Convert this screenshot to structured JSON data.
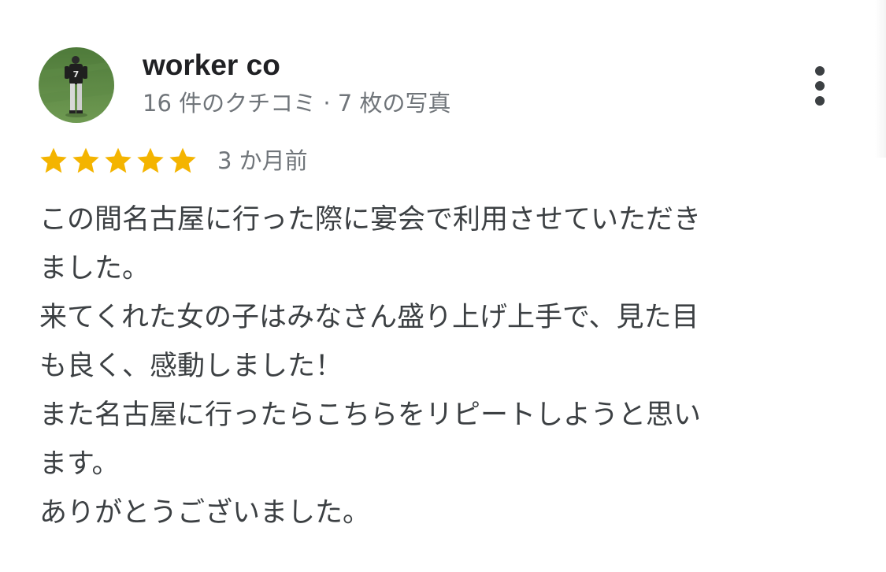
{
  "reviewer": {
    "name": "worker co",
    "meta": "16 件のクチコミ · 7 枚の写真",
    "avatar": "profile-photo"
  },
  "rating": {
    "stars": 5,
    "max": 5,
    "color": "#f4b400",
    "date": "3 か月前"
  },
  "review": {
    "lines": [
      "この間名古屋に行った際に宴会で利用させていただき",
      "ました。",
      "来てくれた女の子はみなさん盛り上げ上手で、見た目",
      "も良く、感動しました！",
      "また名古屋に行ったらこちらをリピートしようと思い",
      "ます。",
      "ありがとうございました。"
    ]
  },
  "icons": {
    "more": "more-vertical-icon",
    "star": "star-icon"
  }
}
